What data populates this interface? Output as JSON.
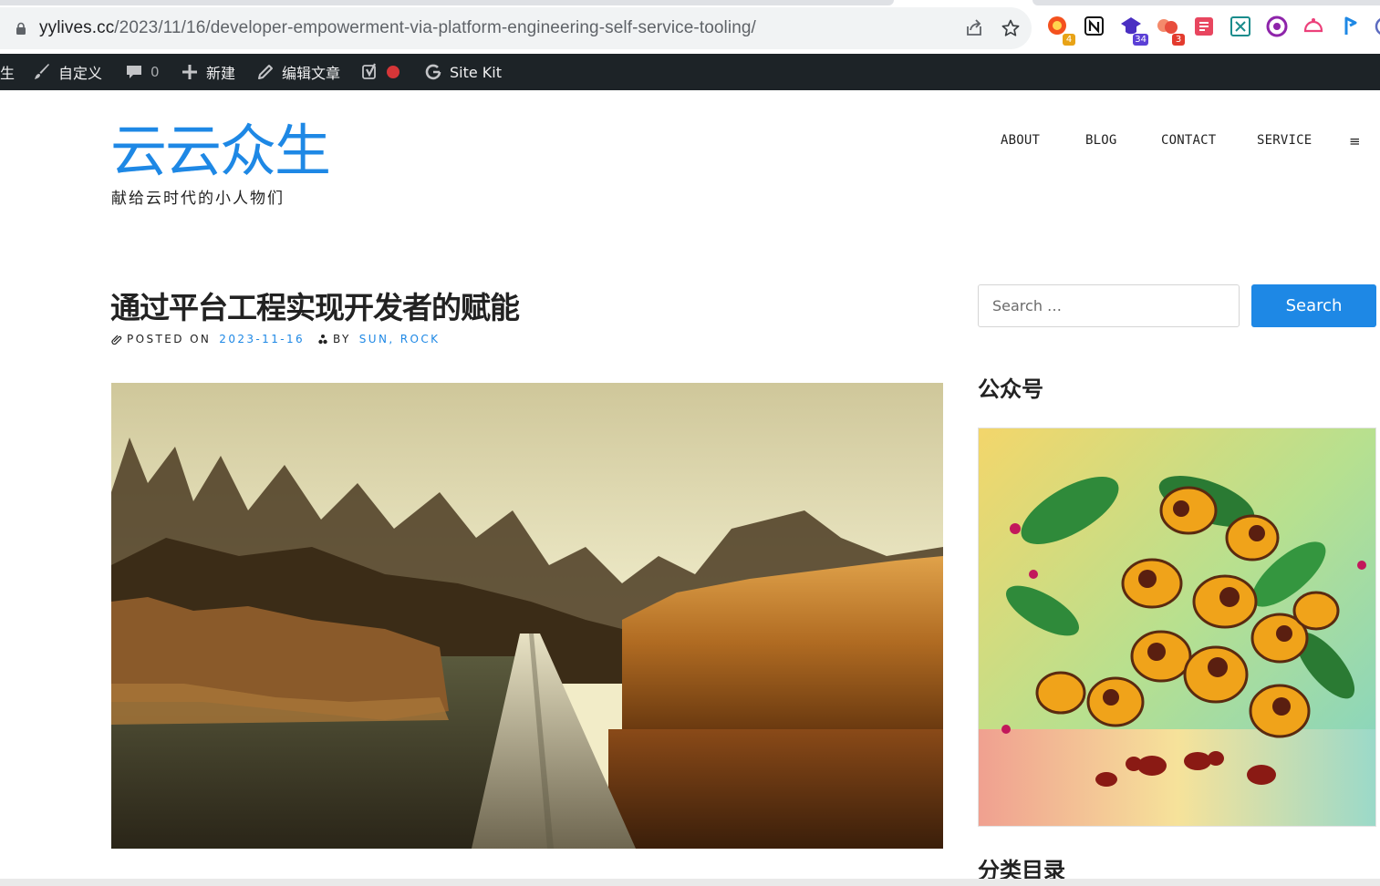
{
  "browser": {
    "url_host": "yylives.cc",
    "url_path": "/2023/11/16/developer-empowerment-via-platform-engineering-self-service-tooling/",
    "extensions": [
      {
        "name": "ext-1",
        "badge": "4",
        "badge_color": "#e8a317"
      },
      {
        "name": "notion",
        "badge": ""
      },
      {
        "name": "ext-3",
        "badge": "34",
        "badge_color": "#5b3fd6"
      },
      {
        "name": "ext-4",
        "badge": "3",
        "badge_color": "#e33b2e"
      },
      {
        "name": "ext-5",
        "badge": ""
      },
      {
        "name": "ext-6",
        "badge": ""
      },
      {
        "name": "ext-7",
        "badge": ""
      },
      {
        "name": "ext-8",
        "badge": ""
      },
      {
        "name": "ext-9",
        "badge": ""
      }
    ]
  },
  "admin_bar": {
    "site_name_fragment": "生",
    "customize": "自定义",
    "comments_count": "0",
    "new": "新建",
    "edit_post": "编辑文章",
    "site_kit": "Site Kit"
  },
  "site": {
    "title": "云云众生",
    "tagline": "献给云时代的小人物们",
    "accent": "#1e88e5"
  },
  "nav": {
    "items": [
      "ABOUT",
      "BLOG",
      "CONTACT",
      "SERVICE"
    ],
    "menu_toggle": "≡"
  },
  "post": {
    "title": "通过平台工程实现开发者的赋能",
    "posted_on_label": "POSTED ON",
    "date": "2023-11-16",
    "by_label": "BY",
    "author": "SUN, ROCK"
  },
  "sidebar": {
    "search_placeholder": "Search …",
    "search_button": "Search",
    "widget_gzh_title": "公众号",
    "widget_categories_title": "分类目录"
  }
}
